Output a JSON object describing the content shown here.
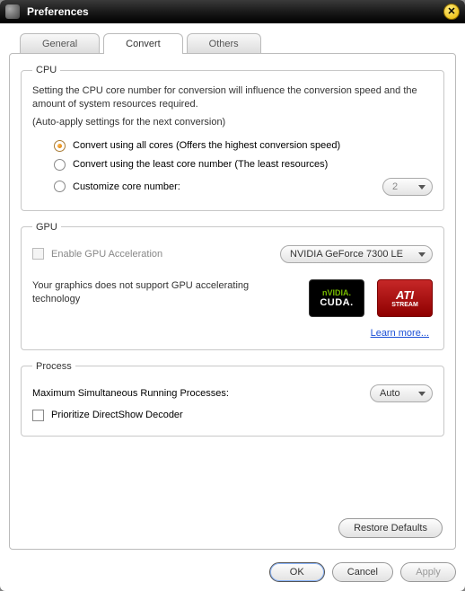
{
  "window": {
    "title": "Preferences"
  },
  "tabs": {
    "general": "General",
    "convert": "Convert",
    "others": "Others"
  },
  "cpu": {
    "legend": "CPU",
    "desc": "Setting the CPU core number for conversion will influence the conversion speed and the amount of system resources required.",
    "auto_note": "(Auto-apply settings for the next conversion)",
    "opt_all": "Convert using all cores (Offers the highest conversion speed)",
    "opt_least": "Convert using the least core number (The least resources)",
    "opt_custom": "Customize core number:",
    "custom_value": "2"
  },
  "gpu": {
    "legend": "GPU",
    "enable_label": "Enable GPU Acceleration",
    "device": "NVIDIA GeForce 7300 LE",
    "unsupported": "Your graphics does not support GPU accelerating technology",
    "nvidia_brand": "nVIDIA.",
    "nvidia_sub": "CUDA.",
    "ati_brand": "ATI",
    "ati_sub": "STREAM",
    "learn_more": "Learn more..."
  },
  "process": {
    "legend": "Process",
    "max_label": "Maximum Simultaneous Running Processes:",
    "max_value": "Auto",
    "prioritize_label": "Prioritize DirectShow Decoder"
  },
  "buttons": {
    "restore": "Restore Defaults",
    "ok": "OK",
    "cancel": "Cancel",
    "apply": "Apply"
  }
}
